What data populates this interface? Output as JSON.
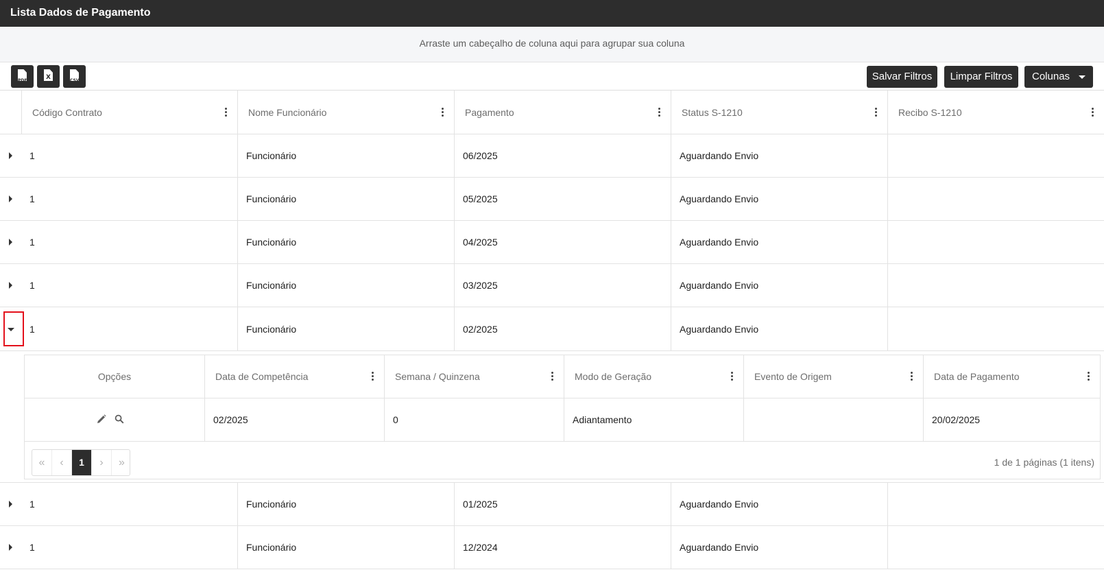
{
  "window": {
    "title": "Lista Dados de Pagamento"
  },
  "group_panel": {
    "hint": "Arraste um cabeçalho de coluna aqui para agrupar sua coluna"
  },
  "toolbar": {
    "export_pdf_label": "PDF",
    "export_excel_label": "X",
    "export_csv_label": "CSV",
    "save_filters_label": "Salvar Filtros",
    "clear_filters_label": "Limpar Filtros",
    "columns_label": "Colunas"
  },
  "grid": {
    "columns": [
      "Código Contrato",
      "Nome Funcionário",
      "Pagamento",
      "Status S-1210",
      "Recibo S-1210"
    ],
    "rows": [
      {
        "codigo": "1",
        "nome": "Funcionário",
        "pagamento": "06/2025",
        "status": "Aguardando Envio",
        "recibo": ""
      },
      {
        "codigo": "1",
        "nome": "Funcionário",
        "pagamento": "05/2025",
        "status": "Aguardando Envio",
        "recibo": ""
      },
      {
        "codigo": "1",
        "nome": "Funcionário",
        "pagamento": "04/2025",
        "status": "Aguardando Envio",
        "recibo": ""
      },
      {
        "codigo": "1",
        "nome": "Funcionário",
        "pagamento": "03/2025",
        "status": "Aguardando Envio",
        "recibo": ""
      },
      {
        "codigo": "1",
        "nome": "Funcionário",
        "pagamento": "02/2025",
        "status": "Aguardando Envio",
        "recibo": "",
        "expanded": true
      },
      {
        "codigo": "1",
        "nome": "Funcionário",
        "pagamento": "01/2025",
        "status": "Aguardando Envio",
        "recibo": ""
      },
      {
        "codigo": "1",
        "nome": "Funcionário",
        "pagamento": "12/2024",
        "status": "Aguardando Envio",
        "recibo": ""
      }
    ]
  },
  "detail": {
    "columns": [
      "Opções",
      "Data de Competência",
      "Semana / Quinzena",
      "Modo de Geração",
      "Evento de Origem",
      "Data de Pagamento"
    ],
    "rows": [
      {
        "competencia": "02/2025",
        "semana": "0",
        "modo": "Adiantamento",
        "evento": "",
        "data_pagamento": "20/02/2025"
      }
    ],
    "pager": {
      "first": "«",
      "prev": "‹",
      "current": "1",
      "next": "›",
      "last": "»",
      "info": "1 de 1 páginas (1 itens)"
    }
  },
  "icons": {
    "menu": "vertical-dots-icon",
    "expand": "caret-right-icon",
    "collapse": "caret-down-icon",
    "edit": "pencil-icon",
    "view": "search-icon"
  },
  "colors": {
    "dark": "#2d2d2d",
    "highlight": "#e3101b"
  }
}
